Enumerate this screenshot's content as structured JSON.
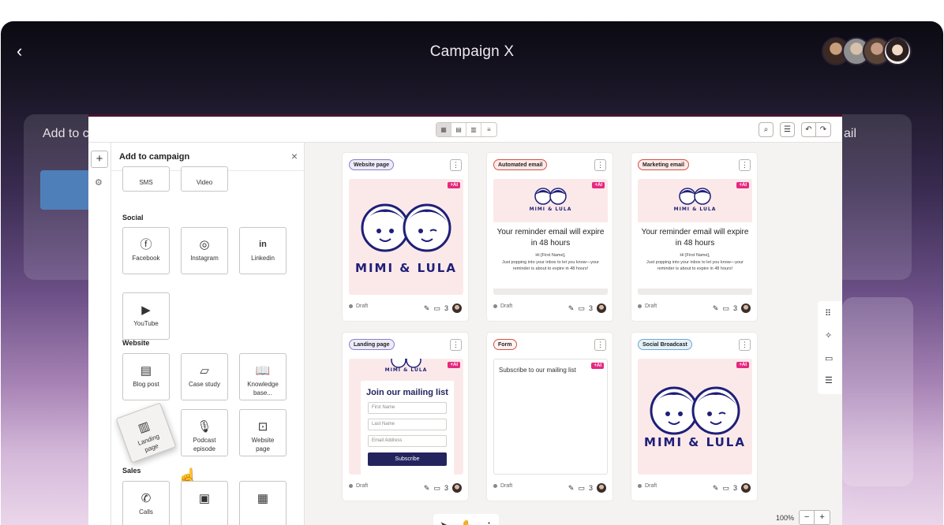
{
  "header": {
    "back_icon": "‹",
    "title": "Campaign X"
  },
  "background": {
    "left_ghost": "Add to c",
    "right_ghost": "ail"
  },
  "toolbar": {
    "view_icons": [
      "▦",
      "▤",
      "▥",
      "≡"
    ],
    "search_icon": "⌕",
    "filter_icon": "☰",
    "undo_icon": "↶",
    "redo_icon": "↷"
  },
  "rail": {
    "plus": "+",
    "gear": "⚙"
  },
  "panel": {
    "title": "Add to campaign",
    "close": "×",
    "top_tiles": [
      {
        "icon": "💬",
        "label": "SMS"
      },
      {
        "icon": "▷",
        "label": "Video"
      }
    ],
    "social_label": "Social",
    "social": [
      {
        "icon": "ⓕ",
        "label": "Facebook"
      },
      {
        "icon": "◎",
        "label": "Instagram"
      },
      {
        "icon": "in",
        "label": "Linkedin"
      },
      {
        "icon": "▶",
        "label": "YouTube"
      }
    ],
    "website_label": "Website",
    "website": [
      {
        "icon": "▤",
        "label": "Blog post"
      },
      {
        "icon": "▱",
        "label": "Case study"
      },
      {
        "icon": "📖",
        "label": "Knowledge base..."
      },
      {
        "icon": "▥",
        "label": "Landing page"
      },
      {
        "icon": "🎙",
        "label": "Podcast episode"
      },
      {
        "icon": "⊡",
        "label": "Website page"
      }
    ],
    "sales_label": "Sales",
    "sales": [
      {
        "icon": "✆",
        "label": "Calls"
      },
      {
        "icon": "▣",
        "label": ""
      },
      {
        "icon": "▦",
        "label": ""
      }
    ]
  },
  "cards": [
    {
      "type": "Website page",
      "status": "Draft",
      "comments": "3",
      "ai": "+AI"
    },
    {
      "type": "Automated email",
      "status": "Draft",
      "comments": "3",
      "ai": "+AI"
    },
    {
      "type": "Marketing email",
      "status": "Draft",
      "comments": "3",
      "ai": "+AI"
    },
    {
      "type": "Landing page",
      "status": "Draft",
      "comments": "3",
      "ai": "+AI"
    },
    {
      "type": "Form",
      "status": "Draft",
      "comments": "3",
      "ai": "+AI"
    },
    {
      "type": "Social Broadcast",
      "status": "Draft",
      "comments": "3",
      "ai": "+AI"
    }
  ],
  "brand": {
    "logo": "MIMI & LULA",
    "logo_color": "#1f1f78"
  },
  "email": {
    "headline": "Your reminder email will expire in 48 hours",
    "greeting": "Hi [First Name],",
    "body": "Just popping into your inbox to let you know—your reminder is about to expire in 48 hours!"
  },
  "landing": {
    "heading": "Join our mailing list",
    "first_name": "First Name",
    "last_name": "Last Name",
    "email": "Email Address",
    "button": "Subscribe"
  },
  "form": {
    "text": "Subscribe to our mailing list"
  },
  "zoom": {
    "level": "100%",
    "minus": "−",
    "plus": "+"
  }
}
